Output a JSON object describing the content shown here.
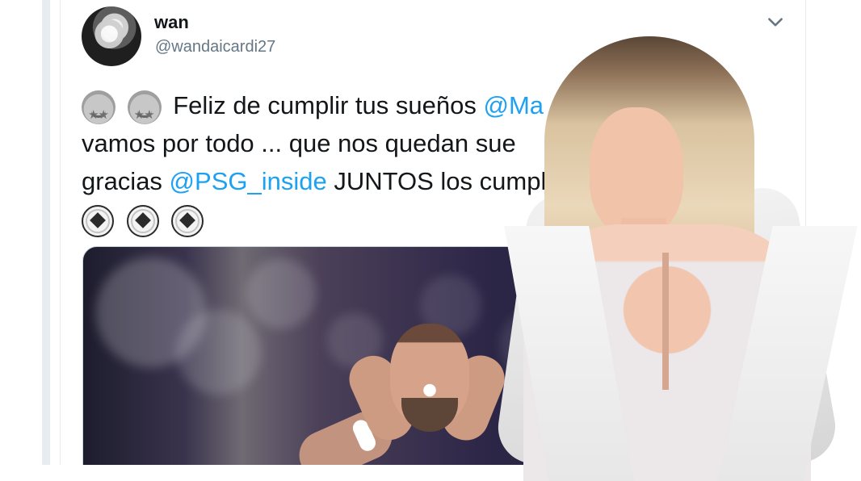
{
  "tweet": {
    "display_name": "wan",
    "username": "@wandaicardi27",
    "text_lines": [
      "Feliz de cumplir tus sueños @Ma",
      "vamos por todo ...  que nos quedan sue",
      "gracias @PSG_inside JUNTOS los cumplir"
    ],
    "line1_before_mention": "Feliz de cumplir tus sueños ",
    "line1_mention": "@Ma",
    "line2_text": "vamos por todo ...  que nos quedan sue",
    "line2_right_fragment": "plir",
    "line3_before_mention": "gracias ",
    "line3_mention": "@PSG_inside",
    "line3_after_mention": " JUNTOS los cumplir"
  },
  "icons": {
    "menu": "chevron-down-icon",
    "emoji_star": "star-struck-emoji",
    "emoji_ball": "soccer-ball-emoji"
  },
  "colors": {
    "mention": "#1da1f2",
    "text_primary": "#14171a",
    "text_secondary": "#657786"
  }
}
